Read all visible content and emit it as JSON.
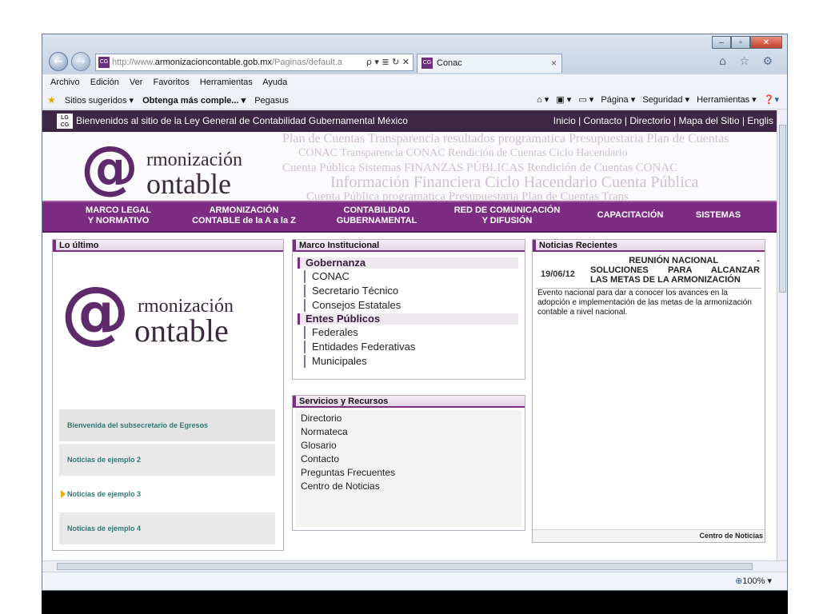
{
  "browser": {
    "url_prefix": "http://www.",
    "url_domain": "armonizacioncontable.gob.mx",
    "url_suffix": "/Paginas/default.a",
    "addr_buttons": "ρ ▾ ≣ ↻ ✕",
    "tab_label": "Conac",
    "tab_close": "×",
    "favicon": "CG",
    "menu": [
      "Archivo",
      "Edición",
      "Ver",
      "Favoritos",
      "Herramientas",
      "Ayuda"
    ],
    "fav_left": [
      "Sitios sugeridos ▾",
      "Obtenga más comple... ▾",
      "Pegasus"
    ],
    "fav_right": [
      "Página ▾",
      "Seguridad ▾",
      "Herramientas ▾"
    ],
    "zoom": "100%",
    "toolbar_icons": "⌂ ☆ ⚙",
    "icons": {
      "back": "back-arrow-icon",
      "forward": "forward-arrow-icon",
      "home": "home-icon",
      "favorites": "star-icon",
      "tools": "gear-icon",
      "close": "close-icon"
    }
  },
  "site": {
    "lgcg": "LG CG",
    "welcome": "Bienvenidos al sitio de la Ley General de Contabilidad Gubernamental México",
    "top_links": "Inicio | Contacto | Directorio | Mapa del Sitio | Englis",
    "logo": {
      "at": "@",
      "line1": "rmonización",
      "line2": "ontable"
    },
    "banner_words": [
      "Plan de Cuentas  Transparencia  resultados  programatica  Presupuestaria  Plan de Cuentas",
      "CONAC  Transparencia  CONAC  Rendición de Cuentas  Ciclo Hacendario",
      "Cuenta Pública  Sistemas FINANZAS PÚBLICAS  Rendición de Cuentas  CONAC",
      "Información Financiera  Ciclo Hacendario  Cuenta Pública",
      "Cuenta Pública  programatica  Presupuestaria  Plan de Cuentas  Trans"
    ],
    "nav": [
      {
        "line1": "MARCO LEGAL",
        "line2": "Y NORMATIVO"
      },
      {
        "line1": "ARMONIZACIÓN",
        "line2": "CONTABLE de la A a la Z"
      },
      {
        "line1": "CONTABILIDAD",
        "line2": "GUBERNAMENTAL"
      },
      {
        "line1": "RED DE COMUNICACIÓN",
        "line2": "Y DIFUSIÓN"
      },
      {
        "line1": "CAPACITACIÓN",
        "line2": ""
      },
      {
        "line1": "SISTEMAS",
        "line2": ""
      }
    ]
  },
  "lo_ultimo": {
    "title": "Lo último",
    "items": [
      "Bienvenida del subsecretario de Egresos",
      "Noticias de ejemplo 2",
      "Noticias de ejemplo 3",
      "Noticias de ejemplo 4"
    ]
  },
  "marco": {
    "title": "Marco Institucional",
    "groups": [
      {
        "name": "Gobernanza",
        "items": [
          "CONAC",
          "Secretario Técnico",
          "Consejos Estatales"
        ]
      },
      {
        "name": "Entes Públicos",
        "items": [
          "Federales",
          "Entidades Federativas",
          "Municipales"
        ]
      }
    ]
  },
  "servicios": {
    "title": "Servicios y Recursos",
    "items": [
      "Directorio",
      "Normateca",
      "Glosario",
      "Contacto",
      "Preguntas Frecuentes",
      "Centro de Noticias"
    ]
  },
  "noticias": {
    "title": "Noticias Recientes",
    "date": "19/06/12",
    "headline_1": "REUNIÓN NACIONAL",
    "headline_2": "SOLUCIONES PARA ALCANZAR",
    "headline_3": "LAS METAS DE LA ARMONIZACIÓN",
    "dash": "-",
    "body": "Evento nacional para dar a conocer los avances en la adopción e implementación de las metas de la armonización contable a nivel nacional.",
    "footer_link": "Centro de Noticias"
  },
  "colors": {
    "brand_purple": "#7d2c83",
    "dark_strip": "#3d2745",
    "news_teal": "#2c7a72"
  }
}
